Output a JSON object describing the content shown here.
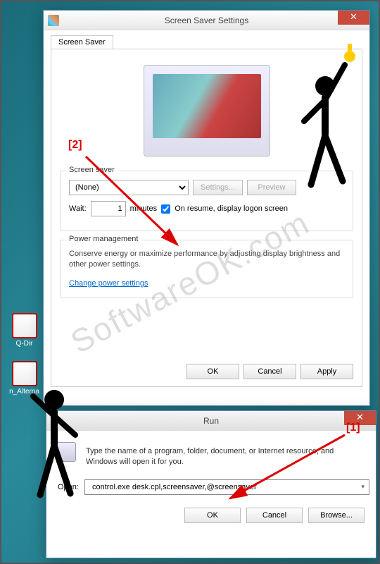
{
  "desktop": {
    "icons": [
      {
        "label": "Q-Dir"
      },
      {
        "label": "n_Alterna"
      }
    ]
  },
  "screensaver_window": {
    "title": "Screen Saver Settings",
    "tab_label": "Screen Saver",
    "group_screensaver": {
      "legend": "Screen saver",
      "dropdown_value": "(None)",
      "settings_btn": "Settings...",
      "preview_btn": "Preview",
      "wait_label": "Wait:",
      "wait_value": "1",
      "minutes_label": "minutes",
      "resume_label": "On resume, display logon screen"
    },
    "group_power": {
      "legend": "Power management",
      "text": "Conserve energy or maximize performance by adjusting display brightness and other power settings.",
      "link": "Change power settings"
    },
    "buttons": {
      "ok": "OK",
      "cancel": "Cancel",
      "apply": "Apply"
    }
  },
  "run_window": {
    "title": "Run",
    "description": "Type the name of a program, folder, document, or Internet resource, and Windows will open it for you.",
    "open_label": "Open:",
    "command": "control.exe desk.cpl,screensaver,@screensaver",
    "buttons": {
      "ok": "OK",
      "cancel": "Cancel",
      "browse": "Browse..."
    }
  },
  "annotations": {
    "a1": "[1]",
    "a2": "[2]"
  },
  "watermark": "SoftwareOK.com"
}
